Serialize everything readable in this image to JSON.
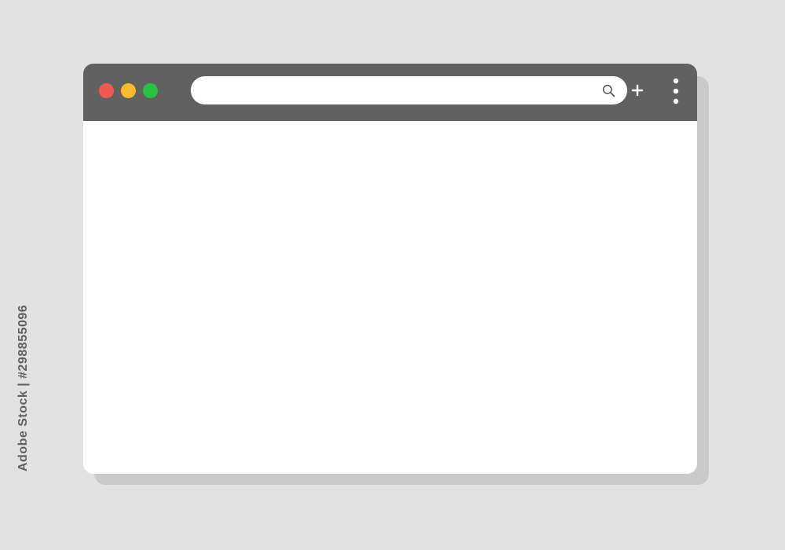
{
  "window": {
    "traffic_lights": [
      {
        "name": "close",
        "color": "#f15a50"
      },
      {
        "name": "minimize",
        "color": "#f9bb2b"
      },
      {
        "name": "maximize",
        "color": "#28c23f"
      }
    ],
    "address_bar": {
      "value": "",
      "placeholder": ""
    },
    "icons": {
      "search": "search-icon",
      "new_tab": "plus-icon",
      "menu": "vertical-dots-icon"
    },
    "colors": {
      "toolbar": "#616161",
      "content": "#ffffff",
      "background": "#e2e2e2",
      "shadow": "#c9c9c9"
    }
  },
  "watermark": {
    "text": "Adobe Stock | #298855096"
  }
}
